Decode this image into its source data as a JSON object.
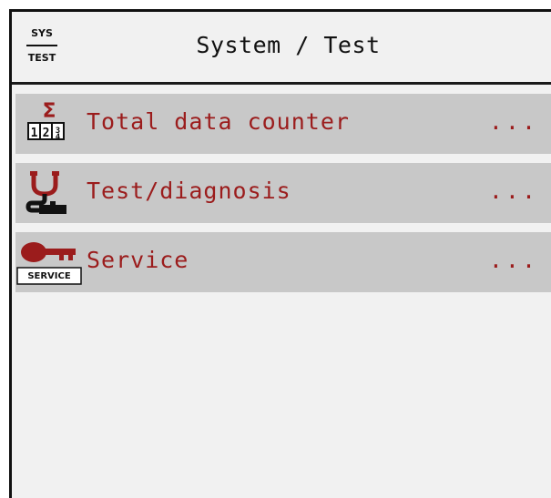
{
  "header": {
    "icon_top": "SYS",
    "icon_bottom": "TEST",
    "title": "System / Test"
  },
  "menu": {
    "items": [
      {
        "label": "Total data counter",
        "more": "...",
        "icon": "sigma-counter-icon"
      },
      {
        "label": "Test/diagnosis",
        "more": "...",
        "icon": "stethoscope-icon"
      },
      {
        "label": "Service",
        "more": "...",
        "icon": "service-key-icon",
        "icon_text": "SERVICE"
      }
    ]
  },
  "colors": {
    "accent_red": "#9b1c1c",
    "row_bg": "#c8c8c8",
    "screen_bg": "#f1f1f1"
  }
}
